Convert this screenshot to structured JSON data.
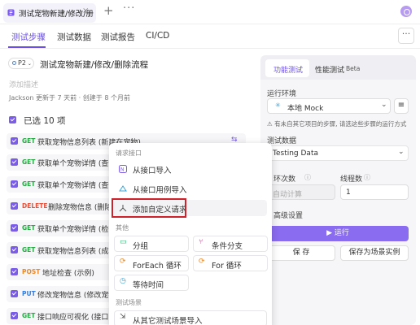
{
  "tab": {
    "title": "测试宠物新建/修改/册",
    "close": "×",
    "plus": "+",
    "more": "···"
  },
  "subtabs": [
    "测试步骤",
    "测试数据",
    "测试报告",
    "CI/CD"
  ],
  "more_btn": "···",
  "case": {
    "priority": "P2",
    "title": "测试宠物新建/修改/删除流程",
    "desc_placeholder": "添加描述",
    "author_line": "Jackson 更新于 7 天前 · 创建于 8 个月前",
    "selected": "已选 10 项"
  },
  "steps": [
    {
      "method": "GET",
      "name": "获取宠物信息列表 (新建在宠物)",
      "color": "#28a745"
    },
    {
      "method": "GET",
      "name": "获取单个宠物详情 (查询",
      "color": "#28a745"
    },
    {
      "method": "GET",
      "name": "获取单个宠物详情 (查询",
      "color": "#28a745"
    },
    {
      "method": "DELETE",
      "name": "删除宠物信息 (删除",
      "color": "#e5533d"
    },
    {
      "method": "GET",
      "name": "获取单个宠物详情 (检查",
      "color": "#28a745"
    },
    {
      "method": "GET",
      "name": "获取宠物信息列表 (成功",
      "color": "#28a745"
    },
    {
      "method": "POST",
      "name": "地址检查 (示例)",
      "color": "#e8892c"
    },
    {
      "method": "PUT",
      "name": "修改宠物信息 (修改宠物",
      "color": "#2f7ee8"
    },
    {
      "method": "GET",
      "name": "接口响应可视化 (接口响",
      "color": "#28a745"
    }
  ],
  "panel": {
    "tab_functional": "功能测试",
    "tab_performance": "性能测试",
    "beta": "Beta",
    "env_label": "运行环境",
    "env_value": "本地 Mock",
    "warning": "有未自其它项目的步骤, 请选这些步骤的运行方式",
    "data_label": "测试数据",
    "data_value": "Testing Data",
    "loops_label": "环次数",
    "loops_value": "自动计算",
    "threads_label": "线程数",
    "threads_value": "1",
    "advanced": "高级设置",
    "run": "▶ 运行",
    "save": "保 存",
    "save_as": "保存为场景实例"
  },
  "menu": {
    "sec_api": "请求接口",
    "import_api": "从接口导入",
    "import_case": "从接口用例导入",
    "custom_request": "添加自定义请求",
    "sec_other": "其他",
    "group": "分组",
    "branch": "条件分支",
    "foreach": "ForEach 循环",
    "for": "For 循环",
    "wait": "等待时间",
    "sec_scene": "测试场景",
    "import_scene": "从其它测试场景导入"
  },
  "colors": {
    "accent": "#6b4fe0",
    "highlight": "#d0202a",
    "run": "#8a6cf0"
  }
}
